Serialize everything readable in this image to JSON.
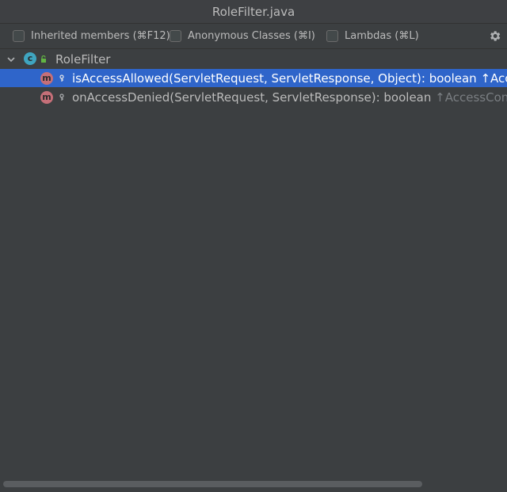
{
  "window": {
    "title": "RoleFilter.java"
  },
  "options": {
    "inherited": {
      "label": "Inherited members (⌘F12)",
      "checked": false
    },
    "anonymous": {
      "label": "Anonymous Classes (⌘I)",
      "checked": false
    },
    "lambdas": {
      "label": "Lambdas (⌘L)",
      "checked": false
    },
    "settings_icon": "gear-icon"
  },
  "tree": {
    "root": {
      "label": "RoleFilter",
      "badge": "c",
      "expanded": true
    },
    "members": [
      {
        "badge": "m",
        "signature": "isAccessAllowed(ServletRequest, ServletResponse, Object): boolean",
        "inherited_from": "↑Acc",
        "selected": true
      },
      {
        "badge": "m",
        "signature": "onAccessDenied(ServletRequest, ServletResponse): boolean",
        "inherited_from": "↑AccessCon",
        "selected": false
      }
    ]
  },
  "colors": {
    "background": "#3c3f41",
    "selection": "#2f65ca",
    "class_badge": "#3fa5c0",
    "method_badge": "#c56f78"
  }
}
